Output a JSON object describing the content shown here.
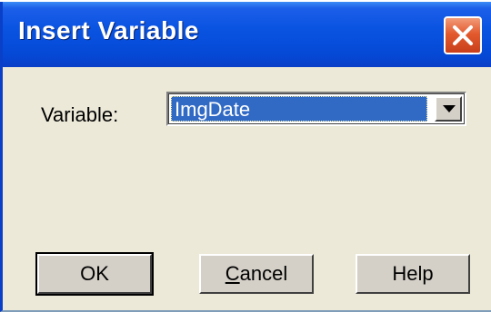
{
  "dialog": {
    "title": "Insert Variable",
    "variable_label": "Variable:",
    "variable_value": "ImgDate",
    "buttons": {
      "ok": "OK",
      "cancel_first": "C",
      "cancel_rest": "ancel",
      "help": "Help"
    }
  },
  "icons": {
    "close": "close-icon",
    "dropdown": "chevron-down-icon"
  },
  "colors": {
    "titlebar": "#0a54e2",
    "close_button": "#e35a2e",
    "selection": "#316ac5",
    "dialog_face": "#ece9d8"
  }
}
